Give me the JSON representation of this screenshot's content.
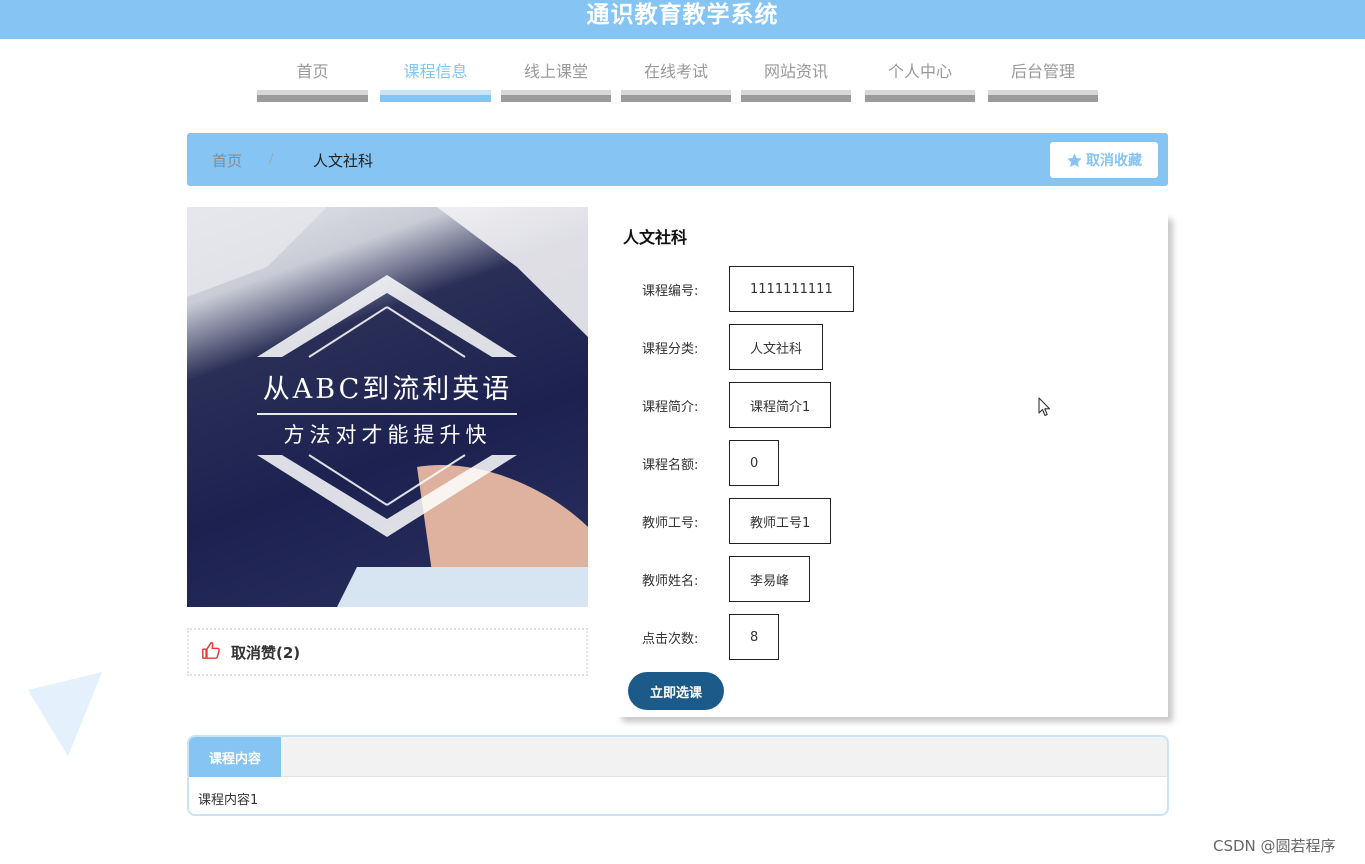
{
  "app": {
    "title": "通识教育教学系统"
  },
  "nav": {
    "items": [
      {
        "label": "首页",
        "active": false
      },
      {
        "label": "课程信息",
        "active": true
      },
      {
        "label": "线上课堂",
        "active": false
      },
      {
        "label": "在线考试",
        "active": false
      },
      {
        "label": "网站资讯",
        "active": false
      },
      {
        "label": "个人中心",
        "active": false
      },
      {
        "label": "后台管理",
        "active": false
      }
    ]
  },
  "breadcrumb": {
    "home": "首页",
    "separator": "/",
    "current": "人文社科"
  },
  "favorite_button": {
    "label": "取消收藏",
    "icon": "star-icon"
  },
  "course_image": {
    "line1": "从ABC到流利英语",
    "line2": "方法对才能提升快"
  },
  "like": {
    "label": "取消赞(2)",
    "icon": "thumbs-up-icon"
  },
  "course": {
    "title": "人文社科",
    "fields": [
      {
        "label": "课程编号:",
        "value": "1111111111"
      },
      {
        "label": "课程分类:",
        "value": "人文社科"
      },
      {
        "label": "课程简介:",
        "value": "课程简介1"
      },
      {
        "label": "课程名额:",
        "value": "0"
      },
      {
        "label": "教师工号:",
        "value": "教师工号1"
      },
      {
        "label": "教师姓名:",
        "value": "李易峰"
      },
      {
        "label": "点击次数:",
        "value": "8"
      }
    ],
    "select_button": "立即选课"
  },
  "content_tab": {
    "tab_label": "课程内容",
    "text": "课程内容1"
  },
  "watermark": "CSDN @圆若程序",
  "colors": {
    "accent": "#85c4f3",
    "button_dark": "#1c5a8a",
    "like_red": "#e23b3b"
  }
}
